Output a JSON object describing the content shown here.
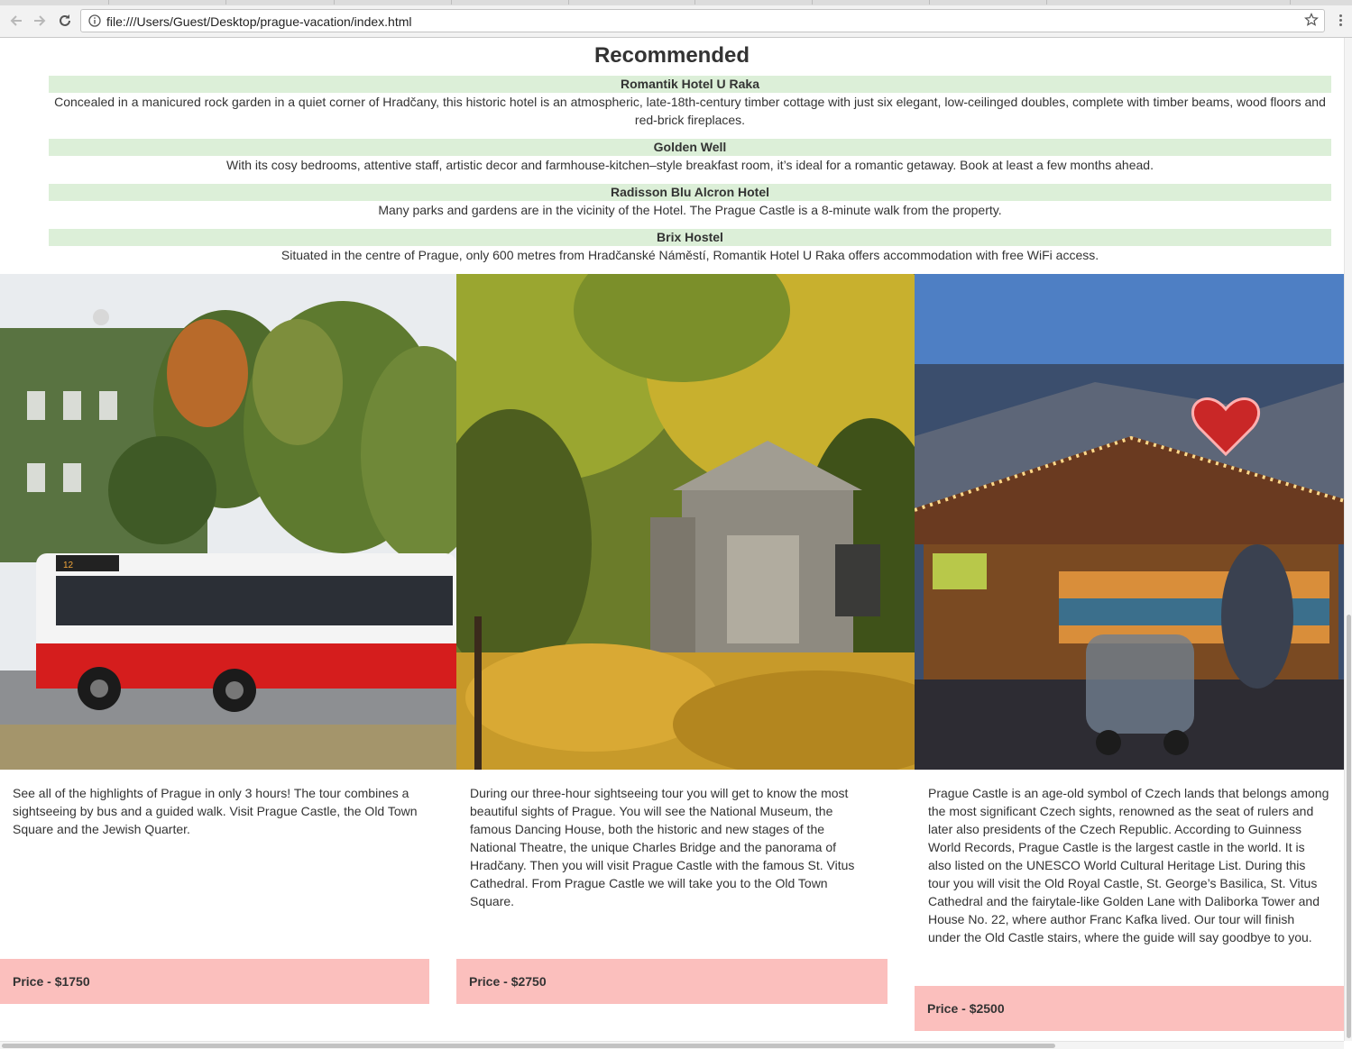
{
  "browser": {
    "url": "file:///Users/Guest/Desktop/prague-vacation/index.html"
  },
  "recommended": {
    "title": "Recommended",
    "hotels": [
      {
        "name": "Romantik Hotel U Raka",
        "description": "Concealed in a manicured rock garden in a quiet corner of Hradčany, this historic hotel is an atmospheric, late-18th-century timber cottage with just six elegant, low-ceilinged doubles, complete with timber beams, wood floors and red-brick fireplaces."
      },
      {
        "name": "Golden Well",
        "description": "With its cosy bedrooms, attentive staff, artistic decor and farmhouse-kitchen–style breakfast room, it’s ideal for a romantic getaway. Book at least a few months ahead."
      },
      {
        "name": "Radisson Blu Alcron Hotel",
        "description": "Many parks and gardens are in the vicinity of the Hotel. The Prague Castle is a 8-minute walk from the property."
      },
      {
        "name": "Brix Hostel",
        "description": "Situated in the centre of Prague, only 600 metres from Hradčanské Náměstí, Romantik Hotel U Raka offers accommodation with free WiFi access."
      }
    ]
  },
  "tours": [
    {
      "image": "city-bus-photo",
      "description": "See all of the highlights of Prague in only 3 hours! The tour combines a sightseeing by bus and a guided walk. Visit Prague Castle, the Old Town Square and the Jewish Quarter.",
      "price": "Price - $1750"
    },
    {
      "image": "autumn-cemetery-photo",
      "description": "During our three-hour sightseeing tour you will get to know the most beautiful sights of Prague. You will see the National Museum, the famous Dancing House, both the historic and new stages of the National Theatre, the unique Charles Bridge and the panorama of Hradčany. Then you will visit Prague Castle with the famous St. Vitus Cathedral. From Prague Castle we will take you to the Old Town Square.",
      "price": "Price - $2750"
    },
    {
      "image": "christmas-market-photo",
      "description": "Prague Castle is an age-old symbol of Czech lands that belongs among the most significant Czech sights, renowned as the seat of rulers and later also presidents of the Czech Republic. According to Guinness World Records, Prague Castle is the largest castle in the world. It is also listed on the UNESCO World Cultural Heritage List. During this tour you will visit the Old Royal Castle, St. George’s Basilica, St. Vitus Cathedral and the fairytale-like Golden Lane with Daliborka Tower and House No. 22, where author Franc Kafka lived. Our tour will finish under the Old Castle stairs, where the guide will say goodbye to you.",
      "price": "Price - $2500"
    }
  ],
  "colors": {
    "hotel_header_bg": "#dcefd8",
    "price_bg": "#fbbfbd"
  }
}
